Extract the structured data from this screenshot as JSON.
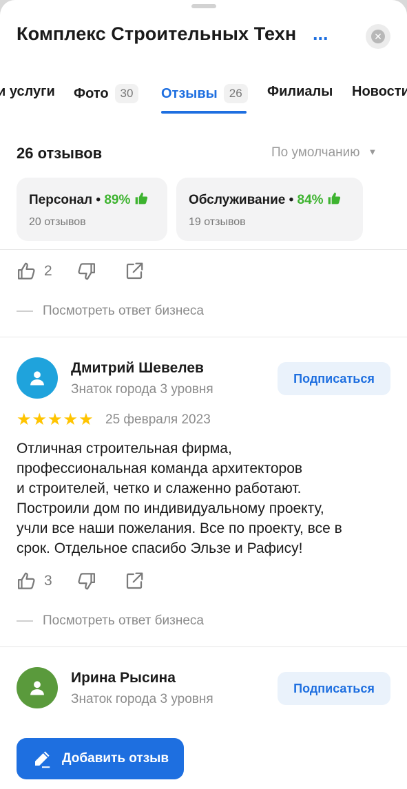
{
  "header": {
    "title": "Комплекс Строительных Техн",
    "title_more": "...",
    "close_icon": "close-icon"
  },
  "tabs": [
    {
      "label": "и услуги",
      "count": ""
    },
    {
      "label": "Фото",
      "count": "30"
    },
    {
      "label": "Отзывы",
      "count": "26",
      "active": true
    },
    {
      "label": "Филиалы",
      "count": ""
    },
    {
      "label": "Новости",
      "count": ""
    }
  ],
  "summary": {
    "count_label": "26 отзывов",
    "sort_label": "По умолчанию"
  },
  "aspects": [
    {
      "name": "Персонал",
      "percent": "89%",
      "reviews": "20 отзывов"
    },
    {
      "name": "Обслуживание",
      "percent": "84%",
      "reviews": "19 отзывов"
    }
  ],
  "reviews": [
    {
      "likes": "2",
      "business_reply": "Посмотреть ответ бизнеса"
    },
    {
      "author": "Дмитрий Шевелев",
      "level": "Знаток города 3 уровня",
      "subscribe": "Подписаться",
      "rating": 5,
      "date": "25 февраля 2023",
      "text_lines": [
        "Отличная строительная фирма,",
        "профессиональная команда архитекторов",
        "и строителей, четко и слаженно работают.",
        "Построили дом по индивидуальному проекту,",
        "учли все наши пожелания. Все по проекту, все в",
        "срок. Отдельное спасибо Эльзе и Рафису!"
      ],
      "likes": "3",
      "business_reply": "Посмотреть ответ бизнеса",
      "avatar_color": "#1fa3dc"
    },
    {
      "author": "Ирина Рысина",
      "level": "Знаток города 3 уровня",
      "subscribe": "Подписаться",
      "avatar_color": "#5a9a3c"
    }
  ],
  "footer": {
    "add_review": "Добавить отзыв"
  },
  "colors": {
    "accent": "#1e6fe0",
    "positive": "#3db32f",
    "star": "#ffc400"
  }
}
